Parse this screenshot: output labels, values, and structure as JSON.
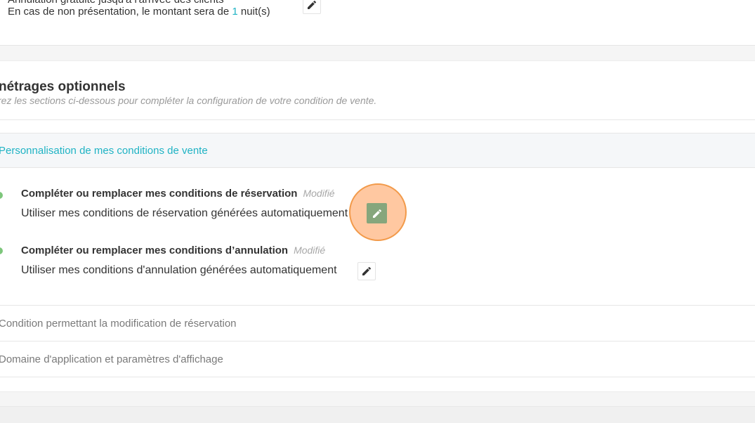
{
  "top": {
    "cut_line": "Annulation gratuite jusqu'à l'arrivée des clients",
    "noshow_prefix": "En cas de non présentation, le montant sera de ",
    "noshow_value": "1",
    "noshow_suffix": " nuit(s)"
  },
  "optional": {
    "title": "nétrages optionnels",
    "subtitle": "rez les sections ci-dessous pour compléter la configuration de votre condition de vente.",
    "accordion": {
      "label": "Personnalisation de mes conditions de vente",
      "items": [
        {
          "title": "Compléter ou remplacer mes conditions de réservation",
          "status": "Modifié",
          "desc": "Utiliser mes conditions de réservation générées automatiquement"
        },
        {
          "title": "Compléter ou remplacer mes conditions d’annulation",
          "status": "Modifié",
          "desc": "Utiliser mes conditions d'annulation générées automatiquement"
        }
      ]
    },
    "rows": [
      "Condition permettant la modification de réservation",
      "Domaine d'application et paramètres d'affichage"
    ]
  },
  "colors": {
    "accent": "#1fb3c4",
    "status_dot": "#7dc67b",
    "highlight": "#f29a4a",
    "active_edit": "#86a67c"
  },
  "icons": {
    "edit": "pencil-icon"
  }
}
